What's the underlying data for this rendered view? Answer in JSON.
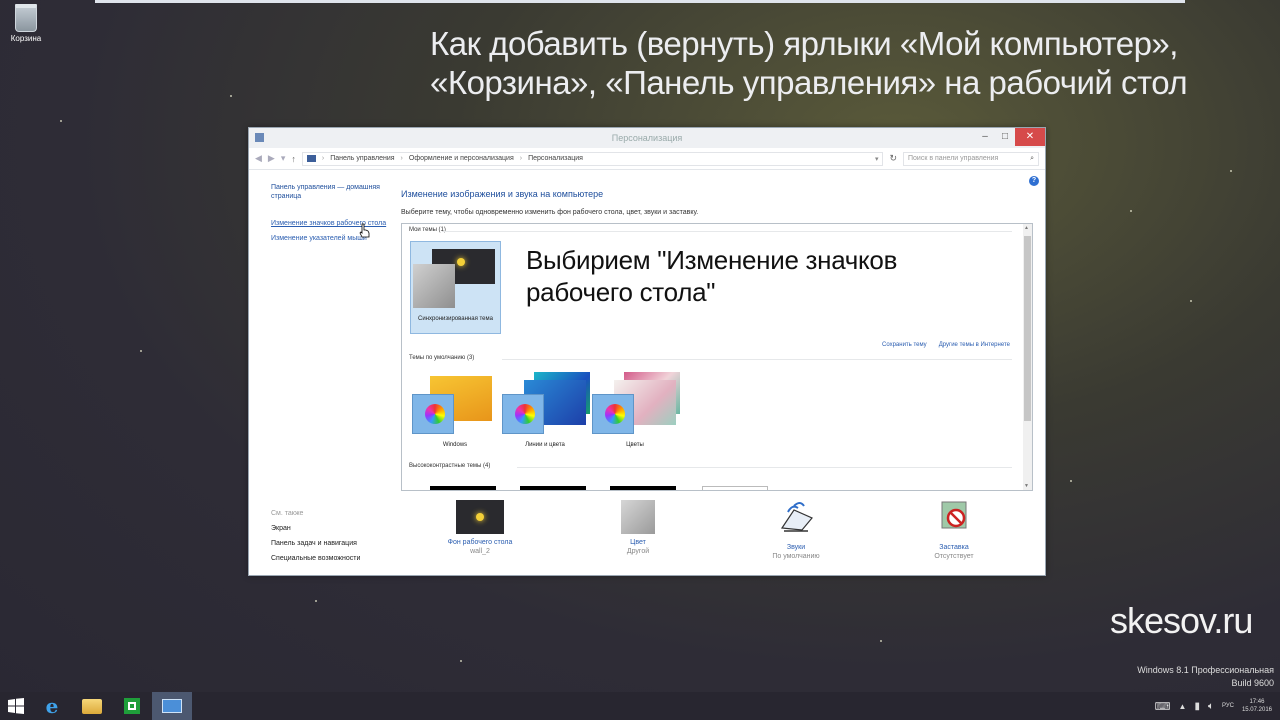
{
  "desktop": {
    "recycle_bin_label": "Корзина",
    "headline_line1": "Как добавить (вернуть) ярлыки «Мой компьютер»,",
    "headline_line2": "«Корзина», «Панель управления» на рабочий стол",
    "watermark": "skesov.ru",
    "windows_edition": "Windows 8.1 Профессиональная",
    "build": "Build 9600"
  },
  "window": {
    "title": "Персонализация",
    "breadcrumbs": [
      "Панель управления",
      "Оформление и персонализация",
      "Персонализация"
    ],
    "search_placeholder": "Поиск в панели управления",
    "sidebar": {
      "home": "Панель управления — домашняя страница",
      "links": [
        "Изменение значков рабочего стола",
        "Изменение указателей мыши"
      ],
      "see_also_header": "См. также",
      "see_also": [
        "Экран",
        "Панель задач и навигация",
        "Специальные возможности"
      ]
    },
    "main": {
      "title": "Изменение изображения и звука на компьютере",
      "subtitle": "Выберите тему, чтобы одновременно изменить фон рабочего стола, цвет, звуки и заставку.",
      "my_themes_label": "Мои темы (1)",
      "my_theme_name": "Синхронизированная тема",
      "overlay_line1": "Выбирием \"Изменение значков",
      "overlay_line2": "рабочего стола\"",
      "save_theme": "Сохранить тему",
      "online_themes": "Другие темы в Интернете",
      "default_themes_label": "Темы по умолчанию (3)",
      "default_themes": [
        "Windows",
        "Линии и цвета",
        "Цветы"
      ],
      "high_contrast_label": "Высококонтрастные темы (4)"
    },
    "bottom": [
      {
        "name": "Фон рабочего стола",
        "sub": "wall_2"
      },
      {
        "name": "Цвет",
        "sub": "Другой"
      },
      {
        "name": "Звуки",
        "sub": "По умолчанию"
      },
      {
        "name": "Заставка",
        "sub": "Отсутствует"
      }
    ]
  },
  "taskbar": {
    "language": "РУС",
    "time": "17:46",
    "date": "15.07.2016"
  }
}
